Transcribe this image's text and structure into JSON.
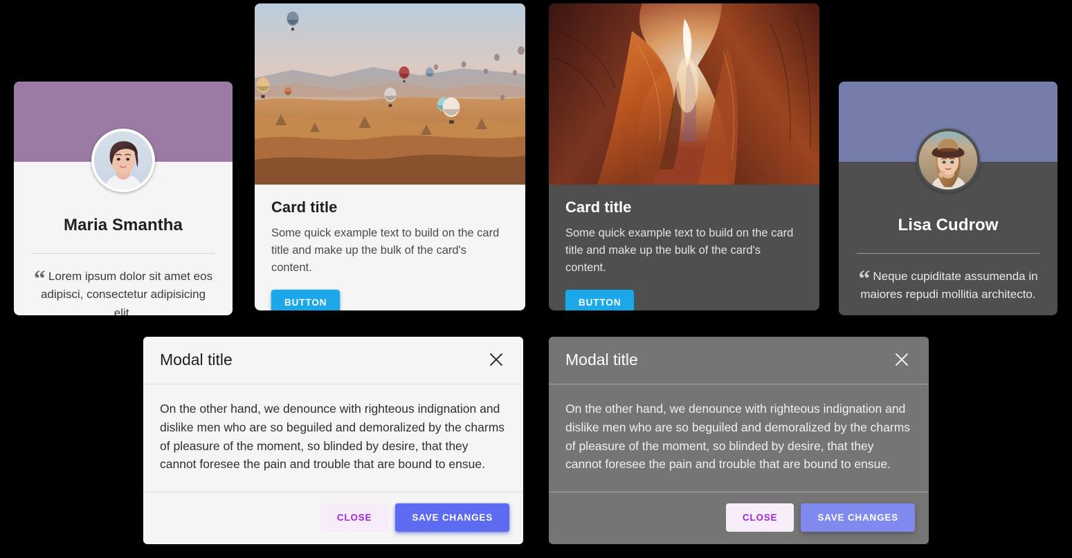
{
  "cards": {
    "maria": {
      "name": "Maria Smantha",
      "quote_mark": "“",
      "quote": "Lorem ipsum dolor sit amet eos adipisci, consectetur adipisicing elit.",
      "banner_color": "#9b7ba4",
      "background_color": "#f5f5f5",
      "avatar_alt": "woman-short-hair-portrait"
    },
    "lisa": {
      "name": "Lisa Cudrow",
      "quote_mark": "“",
      "quote": "Neque cupiditate assumenda in maiores repudi mollitia architecto.",
      "banner_color": "#757dab",
      "background_color": "#4f4f4f",
      "avatar_alt": "woman-with-hat-portrait"
    },
    "media_light": {
      "title": "Card title",
      "text": "Some quick example text to build on the card title and make up the bulk of the card's content.",
      "button_label": "BUTTON",
      "button_color": "#1ca8e8",
      "background_color": "#f5f5f5",
      "image_alt": "hot-air-balloons-over-cappadocia-at-sunrise"
    },
    "media_dark": {
      "title": "Card title",
      "text": "Some quick example text to build on the card title and make up the bulk of the card's content.",
      "button_label": "BUTTON",
      "button_color": "#1ca8e8",
      "background_color": "#4f4f4f",
      "image_alt": "antelope-slot-canyon-light-beam"
    }
  },
  "modals": {
    "light": {
      "title": "Modal title",
      "body": "On the other hand, we denounce with righteous indignation and dislike men who are so beguiled and demoralized by the charms of pleasure of the moment, so blinded by desire, that they cannot foresee the pain and trouble that are bound to ensue.",
      "close_label": "CLOSE",
      "save_label": "SAVE CHANGES",
      "close_icon": "close-x-icon",
      "background_color": "#f5f5f5",
      "save_color": "#5c6bef",
      "close_text_color": "#a626d4"
    },
    "dark": {
      "title": "Modal title",
      "body": "On the other hand, we denounce with righteous indignation and dislike men who are so beguiled and demoralized by the charms of pleasure of the moment, so blinded by desire, that they cannot foresee the pain and trouble that are bound to ensue.",
      "close_label": "CLOSE",
      "save_label": "SAVE CHANGES",
      "close_icon": "close-x-icon",
      "background_color": "#757575",
      "save_color": "#8089ee",
      "close_text_color": "#a626d4"
    }
  }
}
